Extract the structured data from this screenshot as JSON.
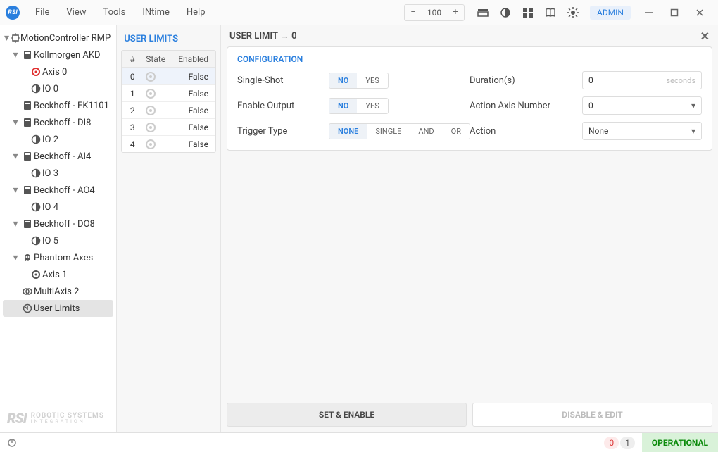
{
  "menubar": {
    "items": [
      "File",
      "View",
      "Tools",
      "INtime",
      "Help"
    ],
    "zoom": {
      "minus": "−",
      "value": "100",
      "plus": "+"
    },
    "admin_label": "ADMIN"
  },
  "tree": [
    {
      "indent": 0,
      "caret": "▾",
      "icon": "controller",
      "label": "MotionController RMP"
    },
    {
      "indent": 1,
      "caret": "▾",
      "icon": "drive",
      "label": "Kollmorgen AKD"
    },
    {
      "indent": 2,
      "caret": "",
      "icon": "axis-red",
      "label": "Axis 0"
    },
    {
      "indent": 2,
      "caret": "",
      "icon": "io",
      "label": "IO 0"
    },
    {
      "indent": 1,
      "caret": "",
      "icon": "module",
      "label": "Beckhoff - EK1101"
    },
    {
      "indent": 1,
      "caret": "▾",
      "icon": "module",
      "label": "Beckhoff - DI8"
    },
    {
      "indent": 2,
      "caret": "",
      "icon": "io",
      "label": "IO 2"
    },
    {
      "indent": 1,
      "caret": "▾",
      "icon": "module",
      "label": "Beckhoff - AI4"
    },
    {
      "indent": 2,
      "caret": "",
      "icon": "io",
      "label": "IO 3"
    },
    {
      "indent": 1,
      "caret": "▾",
      "icon": "module",
      "label": "Beckhoff - AO4"
    },
    {
      "indent": 2,
      "caret": "",
      "icon": "io",
      "label": "IO 4"
    },
    {
      "indent": 1,
      "caret": "▾",
      "icon": "module",
      "label": "Beckhoff - DO8"
    },
    {
      "indent": 2,
      "caret": "",
      "icon": "io",
      "label": "IO 5"
    },
    {
      "indent": 1,
      "caret": "▾",
      "icon": "phantom",
      "label": "Phantom Axes"
    },
    {
      "indent": 2,
      "caret": "",
      "icon": "axis",
      "label": "Axis 1"
    },
    {
      "indent": 1,
      "caret": "",
      "icon": "multiaxis",
      "label": "MultiAxis 2"
    },
    {
      "indent": 1,
      "caret": "",
      "icon": "userlimits",
      "label": "User Limits",
      "selected": true
    }
  ],
  "brand": {
    "logo": "RSI",
    "line1": "ROBOTIC SYSTEMS",
    "line2": "INTEGRATION"
  },
  "limits_panel": {
    "title": "USER LIMITS",
    "columns": {
      "num": "#",
      "state": "State",
      "enabled": "Enabled"
    },
    "rows": [
      {
        "num": "0",
        "enabled": "False",
        "selected": true
      },
      {
        "num": "1",
        "enabled": "False"
      },
      {
        "num": "2",
        "enabled": "False"
      },
      {
        "num": "3",
        "enabled": "False"
      },
      {
        "num": "4",
        "enabled": "False"
      }
    ]
  },
  "detail": {
    "header": "USER LIMIT → 0",
    "config_title": "CONFIGURATION",
    "rows": {
      "single_shot": {
        "label": "Single-Shot",
        "opts": [
          "NO",
          "YES"
        ],
        "active": 0
      },
      "duration": {
        "label": "Duration(s)",
        "value": "0",
        "suffix": "seconds"
      },
      "enable_out": {
        "label": "Enable Output",
        "opts": [
          "NO",
          "YES"
        ],
        "active": 0
      },
      "action_axis": {
        "label": "Action Axis Number",
        "value": "0"
      },
      "trigger": {
        "label": "Trigger Type",
        "opts": [
          "NONE",
          "SINGLE",
          "AND",
          "OR"
        ],
        "active": 0
      },
      "action": {
        "label": "Action",
        "value": "None"
      }
    },
    "buttons": {
      "set": "SET & ENABLE",
      "disable": "DISABLE & EDIT"
    }
  },
  "status": {
    "errors": "0",
    "warnings": "1",
    "state": "OPERATIONAL"
  }
}
